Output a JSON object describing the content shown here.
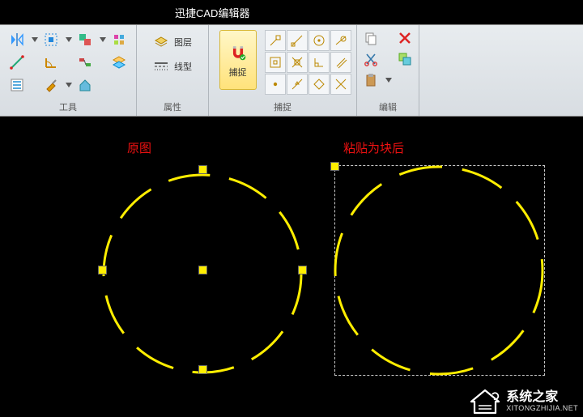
{
  "title": "迅捷CAD编辑器",
  "ribbon": {
    "groups": {
      "tools_label": "工具",
      "props_label": "属性",
      "props_layer": "图层",
      "props_linetype": "线型",
      "snap_label": "捕捉",
      "snap_btn": "捕捉",
      "edit_label": "编辑"
    }
  },
  "canvas": {
    "caption_left": "原图",
    "caption_right": "粘贴为块后"
  },
  "watermark": {
    "name": "系统之家",
    "url": "XITONGZHIJIA.NET"
  }
}
